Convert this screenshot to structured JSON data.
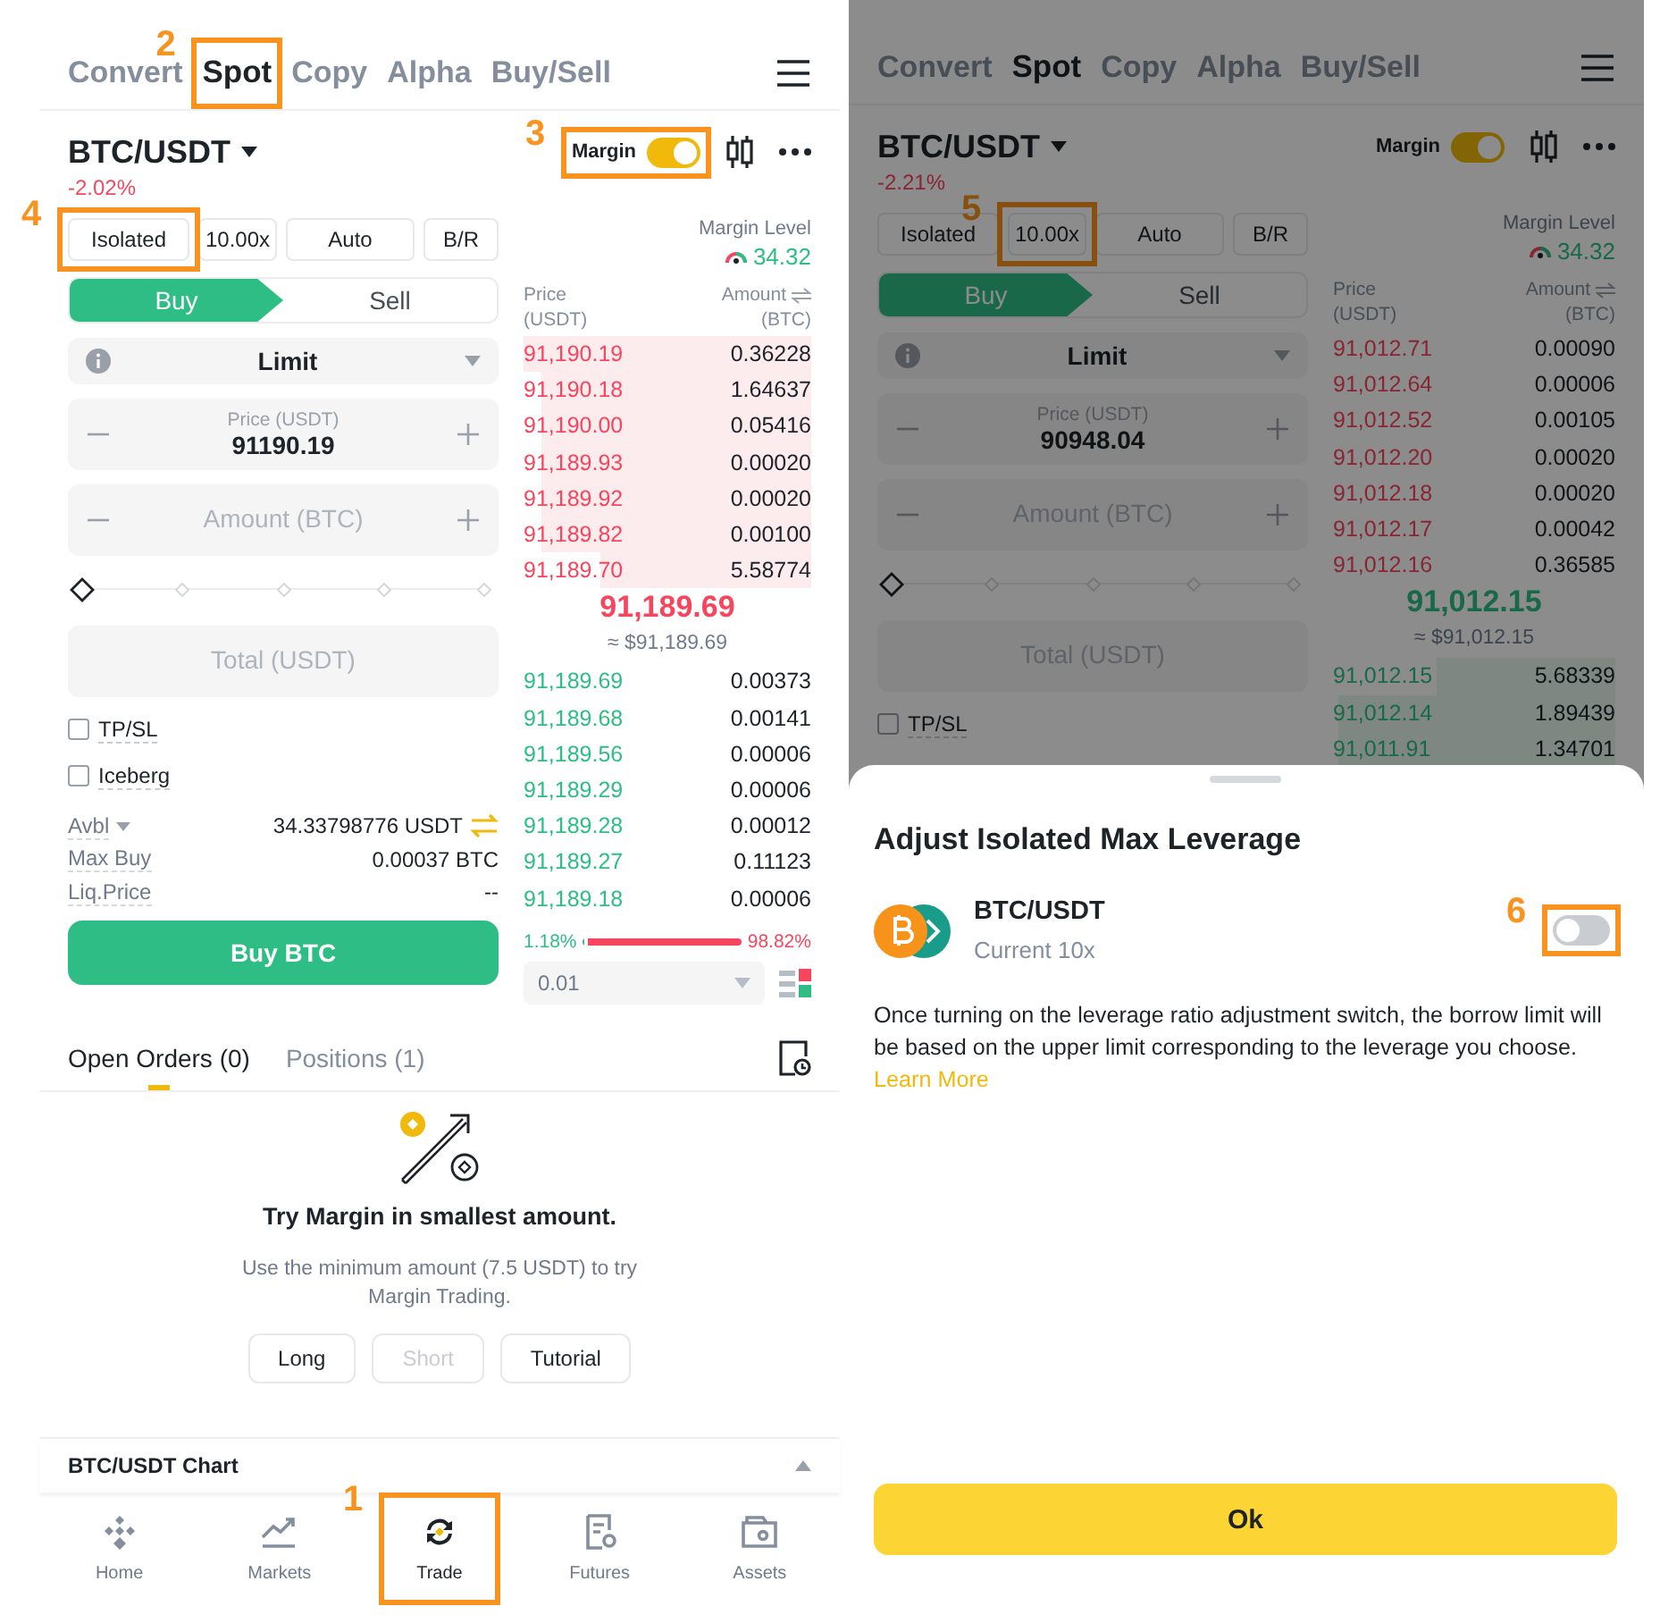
{
  "left": {
    "tabs": [
      {
        "label": "Convert",
        "selected": false
      },
      {
        "label": "Spot",
        "selected": true,
        "annotation": "2"
      },
      {
        "label": "Copy",
        "selected": false
      },
      {
        "label": "Alpha",
        "selected": false
      },
      {
        "label": "Buy/Sell",
        "selected": false
      }
    ],
    "pair": {
      "symbol": "BTC/USDT",
      "change": "-2.02%"
    },
    "margin": {
      "label": "Margin",
      "on": true,
      "annotation": "3"
    },
    "mode_buttons": [
      {
        "label": "Isolated",
        "annotation": "4"
      },
      {
        "label": "10.00x"
      },
      {
        "label": "Auto"
      },
      {
        "label": "B/R"
      }
    ],
    "side_tabs": [
      {
        "label": "Buy",
        "kind": "buy",
        "selected": true
      },
      {
        "label": "Sell",
        "kind": "sell",
        "selected": false
      }
    ],
    "order_type": "Limit",
    "price_field": {
      "label": "Price (USDT)",
      "value": "91190.19"
    },
    "amount_field": {
      "placeholder": "Amount (BTC)"
    },
    "slider": {
      "level": 0
    },
    "total_field": {
      "placeholder": "Total (USDT)"
    },
    "options": [
      {
        "label": "TP/SL",
        "checked": false
      },
      {
        "label": "Iceberg",
        "checked": false
      }
    ],
    "info": [
      {
        "label": "Avbl",
        "value": "34.33798776 USDT",
        "kind": "balance"
      },
      {
        "label": "Max Buy",
        "value": "0.00037 BTC",
        "kind": "plain"
      },
      {
        "label": "Liq.Price",
        "value": "--",
        "kind": "plain"
      }
    ],
    "submit": "Buy BTC",
    "book": {
      "margin_level": {
        "label": "Margin Level",
        "value": "34.32"
      },
      "columns": [
        {
          "label": "Price",
          "unit": "(USDT)"
        },
        {
          "label": "Amount",
          "unit": "(BTC)"
        }
      ],
      "asks": [
        {
          "price": "91,190.19",
          "amount": "0.36228"
        },
        {
          "price": "91,190.18",
          "amount": "1.64637"
        },
        {
          "price": "91,190.00",
          "amount": "0.05416"
        },
        {
          "price": "91,189.93",
          "amount": "0.00020"
        },
        {
          "price": "91,189.92",
          "amount": "0.00020"
        },
        {
          "price": "91,189.82",
          "amount": "0.00100"
        },
        {
          "price": "91,189.70",
          "amount": "5.58774"
        }
      ],
      "last_price": "91,189.69",
      "last_price_usd": "≈ $91,189.69",
      "bids": [
        {
          "price": "91,189.69",
          "amount": "0.00373"
        },
        {
          "price": "91,189.68",
          "amount": "0.00141"
        },
        {
          "price": "91,189.56",
          "amount": "0.00006"
        },
        {
          "price": "91,189.29",
          "amount": "0.00006"
        },
        {
          "price": "91,189.28",
          "amount": "0.00012"
        },
        {
          "price": "91,189.27",
          "amount": "0.11123"
        },
        {
          "price": "91,189.18",
          "amount": "0.00006"
        }
      ],
      "ratio": {
        "buy": "1.18%",
        "sell": "98.82%",
        "level": 0.0118
      },
      "step": "0.01"
    },
    "orders": {
      "tabs": [
        {
          "label": "Open Orders (0)",
          "selected": true
        },
        {
          "label": "Positions (1)",
          "selected": false
        }
      ],
      "empty": {
        "title": "Try Margin in smallest amount.",
        "text": "Use the minimum amount (7.5 USDT) to try Margin Trading.",
        "actions": [
          {
            "label": "Long",
            "disabled": false
          },
          {
            "label": "Short",
            "disabled": true
          },
          {
            "label": "Tutorial",
            "disabled": false
          }
        ]
      }
    },
    "chart_panel": {
      "title": "BTC/USDT Chart"
    },
    "nav": [
      {
        "label": "Home",
        "selected": false
      },
      {
        "label": "Markets",
        "selected": false
      },
      {
        "label": "Trade",
        "selected": true,
        "annotation": "1"
      },
      {
        "label": "Futures",
        "selected": false
      },
      {
        "label": "Assets",
        "selected": false
      }
    ]
  },
  "right": {
    "tabs": [
      {
        "label": "Convert",
        "selected": false
      },
      {
        "label": "Spot",
        "selected": true
      },
      {
        "label": "Copy",
        "selected": false
      },
      {
        "label": "Alpha",
        "selected": false
      },
      {
        "label": "Buy/Sell",
        "selected": false
      }
    ],
    "pair": {
      "symbol": "BTC/USDT",
      "change": "-2.21%"
    },
    "margin": {
      "label": "Margin",
      "on": true
    },
    "mode_buttons": [
      {
        "label": "Isolated"
      },
      {
        "label": "10.00x",
        "annotation": "5"
      },
      {
        "label": "Auto"
      },
      {
        "label": "B/R"
      }
    ],
    "side_tabs": [
      {
        "label": "Buy",
        "kind": "buy",
        "selected": true
      },
      {
        "label": "Sell",
        "kind": "sell",
        "selected": false
      }
    ],
    "order_type": "Limit",
    "price_field": {
      "label": "Price (USDT)",
      "value": "90948.04"
    },
    "amount_field": {
      "placeholder": "Amount (BTC)"
    },
    "slider": {
      "level": 0
    },
    "total_field": {
      "placeholder": "Total (USDT)"
    },
    "options": [
      {
        "label": "TP/SL",
        "checked": false
      }
    ],
    "book": {
      "margin_level": {
        "label": "Margin Level",
        "value": "34.32"
      },
      "columns": [
        {
          "label": "Price",
          "unit": "(USDT)"
        },
        {
          "label": "Amount",
          "unit": "(BTC)"
        }
      ],
      "asks": [
        {
          "price": "91,012.71",
          "amount": "0.00090"
        },
        {
          "price": "91,012.64",
          "amount": "0.00006"
        },
        {
          "price": "91,012.52",
          "amount": "0.00105"
        },
        {
          "price": "91,012.20",
          "amount": "0.00020"
        },
        {
          "price": "91,012.18",
          "amount": "0.00020"
        },
        {
          "price": "91,012.17",
          "amount": "0.00042"
        },
        {
          "price": "91,012.16",
          "amount": "0.36585"
        }
      ],
      "last_price": "91,012.15",
      "last_price_usd": "≈ $91,012.15",
      "bids": [
        {
          "price": "91,012.15",
          "amount": "5.68339"
        },
        {
          "price": "91,012.14",
          "amount": "1.89439"
        },
        {
          "price": "91,011.91",
          "amount": "1.34701"
        }
      ]
    }
  },
  "sheet": {
    "title": "Adjust Isolated Max Leverage",
    "pair": "BTC/USDT",
    "current": "Current 10x",
    "switch": {
      "on": false,
      "annotation": "6"
    },
    "description": {
      "text": "Once turning on the leverage ratio adjustment switch, the borrow limit will be based on the upper limit corresponding to the leverage you choose.",
      "link": "Learn More"
    },
    "confirm": "Ok"
  }
}
